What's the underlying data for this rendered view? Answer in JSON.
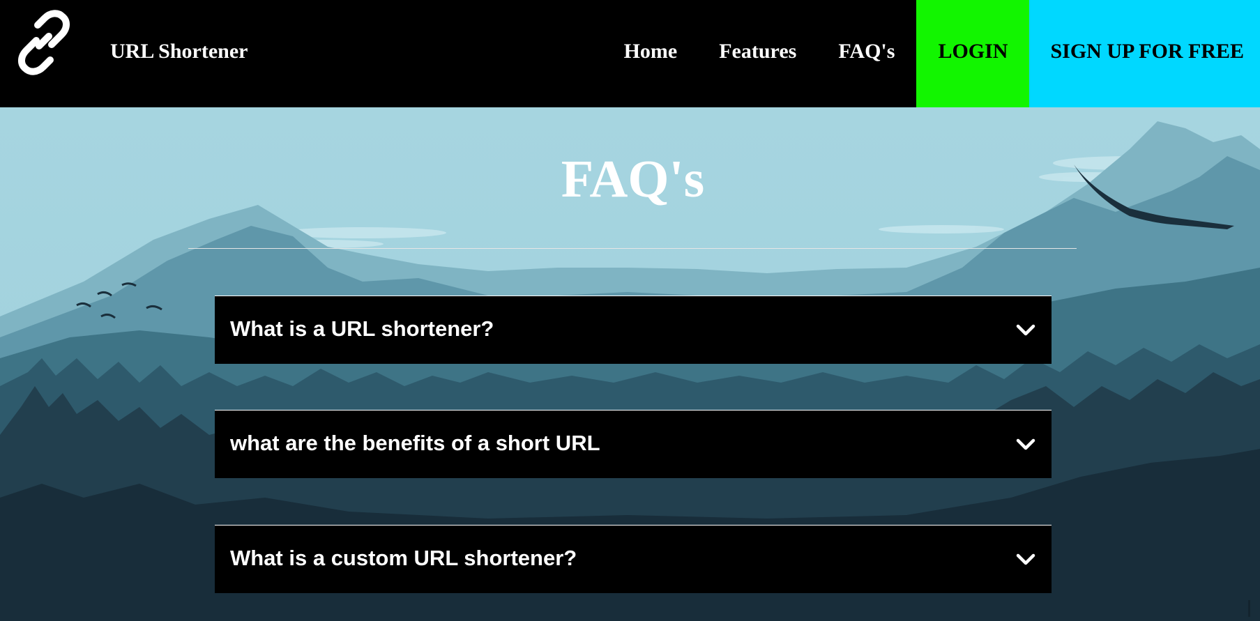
{
  "navbar": {
    "logo_icon": "link-icon",
    "brand": "URL Shortener",
    "links": [
      {
        "label": "Home"
      },
      {
        "label": "Features"
      },
      {
        "label": "FAQ's"
      }
    ],
    "login_label": "LOGIN",
    "signup_label": "SIGN UP FOR FREE",
    "colors": {
      "background": "#000000",
      "login_bg": "#12f500",
      "signup_bg": "#00d8ff"
    }
  },
  "faq": {
    "title": "FAQ's",
    "items": [
      {
        "question": "What is a URL shortener?",
        "icon": "chevron-down-icon"
      },
      {
        "question": "what are the benefits of a short URL",
        "icon": "chevron-down-icon"
      },
      {
        "question": "What is a custom URL shortener?",
        "icon": "chevron-down-icon"
      }
    ]
  },
  "background": {
    "description_icon": "mountain-forest-landscape",
    "sky_color": "#a3d3df"
  }
}
